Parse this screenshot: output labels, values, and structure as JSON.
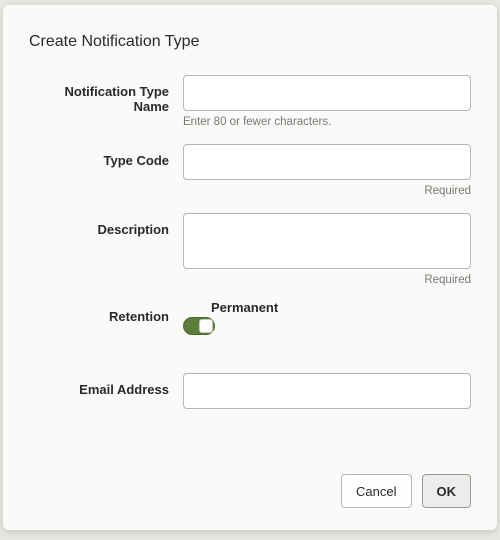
{
  "dialog": {
    "title": "Create Notification Type"
  },
  "fields": {
    "name": {
      "label": "Notification Type Name",
      "value": "",
      "helper": "Enter 80 or fewer characters."
    },
    "typeCode": {
      "label": "Type Code",
      "value": "",
      "helper": "Required"
    },
    "description": {
      "label": "Description",
      "value": "",
      "helper": "Required"
    },
    "retention": {
      "label": "Retention",
      "toggleLabel": "Permanent",
      "on": true
    },
    "email": {
      "label": "Email Address",
      "value": ""
    }
  },
  "buttons": {
    "cancel": "Cancel",
    "ok": "OK"
  }
}
